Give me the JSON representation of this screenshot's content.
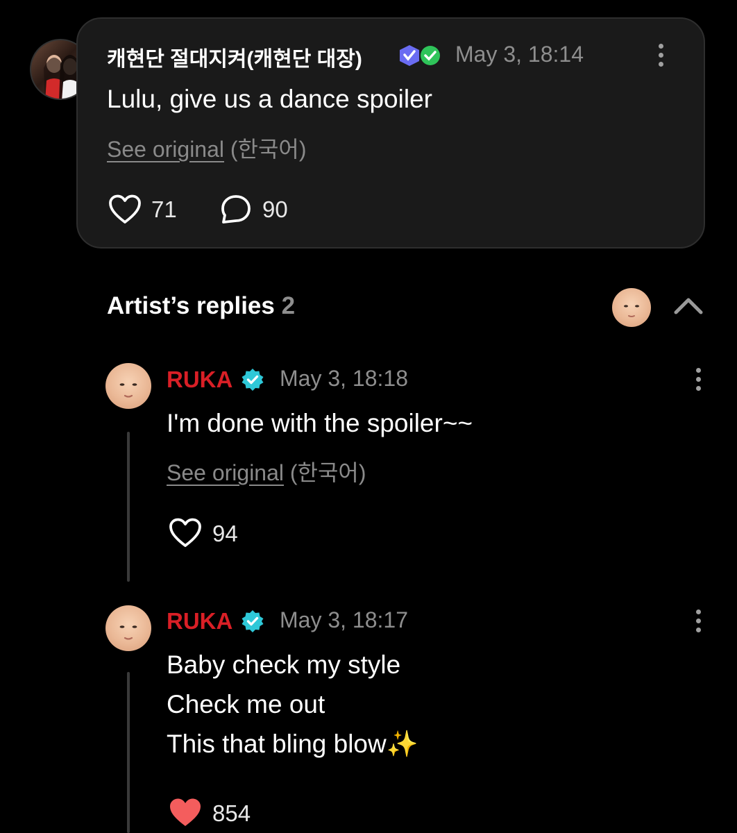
{
  "comment": {
    "author": "캐현단 절대지켜(캐현단 대장)",
    "timestamp": "May 3, 18:14",
    "text": "Lulu, give us a dance spoiler",
    "see_original": "See original",
    "language": "(한국어)",
    "likes": "71",
    "replies": "90"
  },
  "artist_replies": {
    "title": "Artist’s replies",
    "count": "2",
    "items": [
      {
        "author": "RUKA",
        "timestamp": "May 3, 18:18",
        "text": "I'm done with the spoiler~~",
        "see_original": "See original",
        "language": "(한국어)",
        "likes": "94"
      },
      {
        "author": "RUKA",
        "timestamp": "May 3, 18:17",
        "lines": [
          "Baby check my style",
          "Check me out",
          "This that bling blow✨"
        ],
        "likes": "854"
      }
    ]
  },
  "colors": {
    "artist_name": "#d91f26",
    "verified": "#2ec8d8",
    "liked_heart": "#f45d5d"
  }
}
